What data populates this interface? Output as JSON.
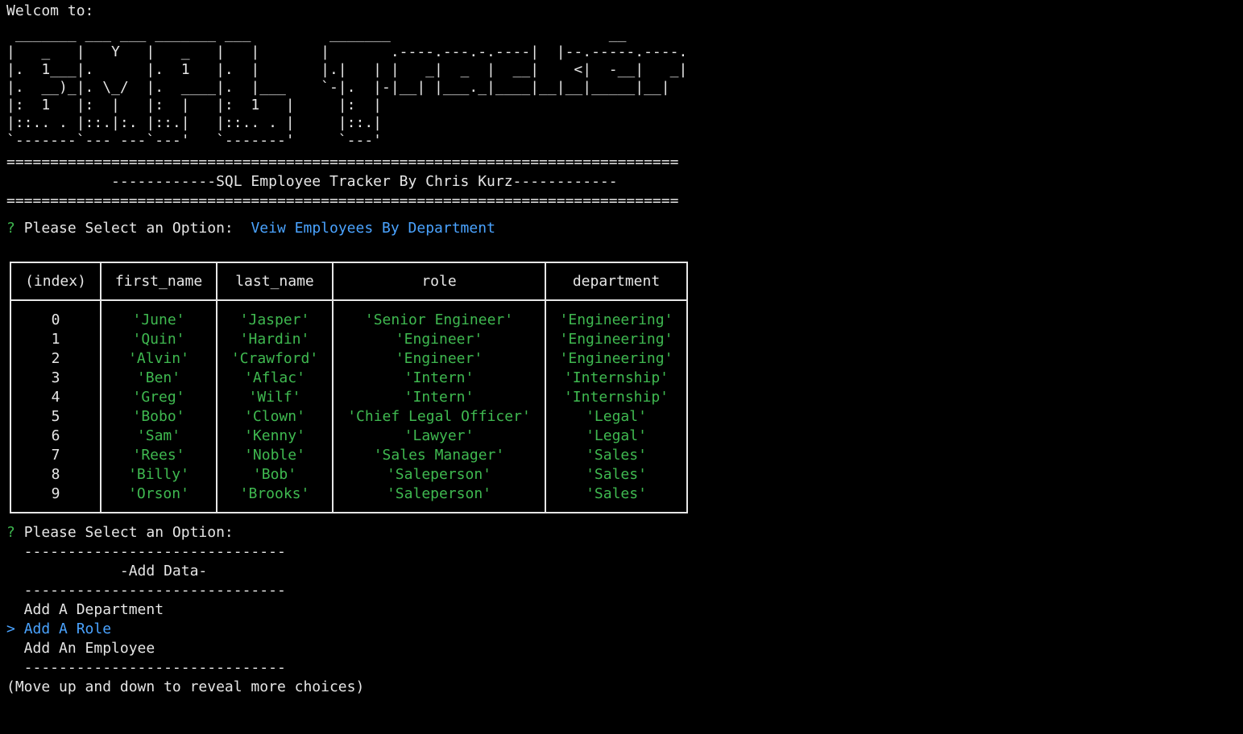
{
  "welcome": "Welcom to:",
  "ascii_logo": " _______ ___ ___ _______ ___         _______                         __\n|   _   |   Y   |   _   |   |       |       .----.---.-.----|  |--.-----.----.\n|.  1___|.      |.  1   |.  |       |.|   | |   _|  _  |  __|    <|  -__|   _|\n|.  __)_|. \\_/  |.  ____|.  |___    `-|.  |-|__| |___._|____|__|__|_____|__|\n|:  1   |:  |   |:  |   |:  1   |     |:  |\n|::.. . |::.|:. |::.|   |::.. . |     |::.|\n`-------`--- ---`---'   `-------'     `---'",
  "separator": "=============================================================================",
  "banner": "            ------------SQL Employee Tracker By Chris Kurz------------",
  "prompt1": {
    "marker": "?",
    "question": "Please Select an Option:",
    "answer": "Veiw Employees By Department"
  },
  "table": {
    "headers": [
      "(index)",
      "first_name",
      "last_name",
      "role",
      "department"
    ],
    "rows": [
      [
        "0",
        "'June'",
        "'Jasper'",
        "'Senior Engineer'",
        "'Engineering'"
      ],
      [
        "1",
        "'Quin'",
        "'Hardin'",
        "'Engineer'",
        "'Engineering'"
      ],
      [
        "2",
        "'Alvin'",
        "'Crawford'",
        "'Engineer'",
        "'Engineering'"
      ],
      [
        "3",
        "'Ben'",
        "'Aflac'",
        "'Intern'",
        "'Internship'"
      ],
      [
        "4",
        "'Greg'",
        "'Wilf'",
        "'Intern'",
        "'Internship'"
      ],
      [
        "5",
        "'Bobo'",
        "'Clown'",
        "'Chief Legal Officer'",
        "'Legal'"
      ],
      [
        "6",
        "'Sam'",
        "'Kenny'",
        "'Lawyer'",
        "'Legal'"
      ],
      [
        "7",
        "'Rees'",
        "'Noble'",
        "'Sales Manager'",
        "'Sales'"
      ],
      [
        "8",
        "'Billy'",
        "'Bob'",
        "'Saleperson'",
        "'Sales'"
      ],
      [
        "9",
        "'Orson'",
        "'Brooks'",
        "'Saleperson'",
        "'Sales'"
      ]
    ]
  },
  "prompt2": {
    "marker": "?",
    "question": "Please Select an Option:",
    "divider": "  ------------------------------",
    "section_title": "             -Add Data-",
    "choices": [
      "  Add A Department",
      "Add A Role",
      "  Add An Employee"
    ],
    "pointer": ">",
    "hint": "(Move up and down to reveal more choices)"
  },
  "colors": {
    "background": "#000000",
    "text": "#e6e6e6",
    "green": "#3fb950",
    "blue": "#4aa3ff"
  }
}
